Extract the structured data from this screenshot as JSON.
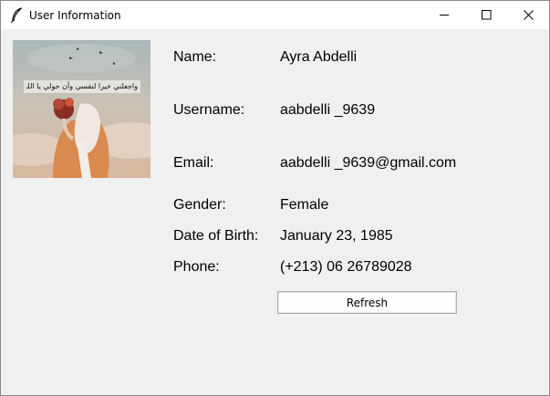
{
  "window": {
    "title": "User Information",
    "icons": {
      "app": "feather-icon",
      "minimize": "minimize-icon",
      "maximize": "maximize-icon",
      "close": "close-icon"
    }
  },
  "profile": {
    "image_caption": "واجعلني خيرا لنفسي وأن حولي يا الله"
  },
  "fields": {
    "name": {
      "label": "Name:",
      "value": "Ayra Abdelli"
    },
    "username": {
      "label": "Username:",
      "value": "aabdelli _9639"
    },
    "email": {
      "label": "Email:",
      "value": "aabdelli _9639@gmail.com"
    },
    "gender": {
      "label": "Gender:",
      "value": "Female"
    },
    "dob": {
      "label": "Date of Birth:",
      "value": "January 23, 1985"
    },
    "phone": {
      "label": "Phone:",
      "value": "(+213) 06 26789028"
    }
  },
  "actions": {
    "refresh_label": "Refresh"
  },
  "colors": {
    "window_bg": "#f0f0f0",
    "titlebar_bg": "#ffffff",
    "button_border": "#adadad"
  }
}
